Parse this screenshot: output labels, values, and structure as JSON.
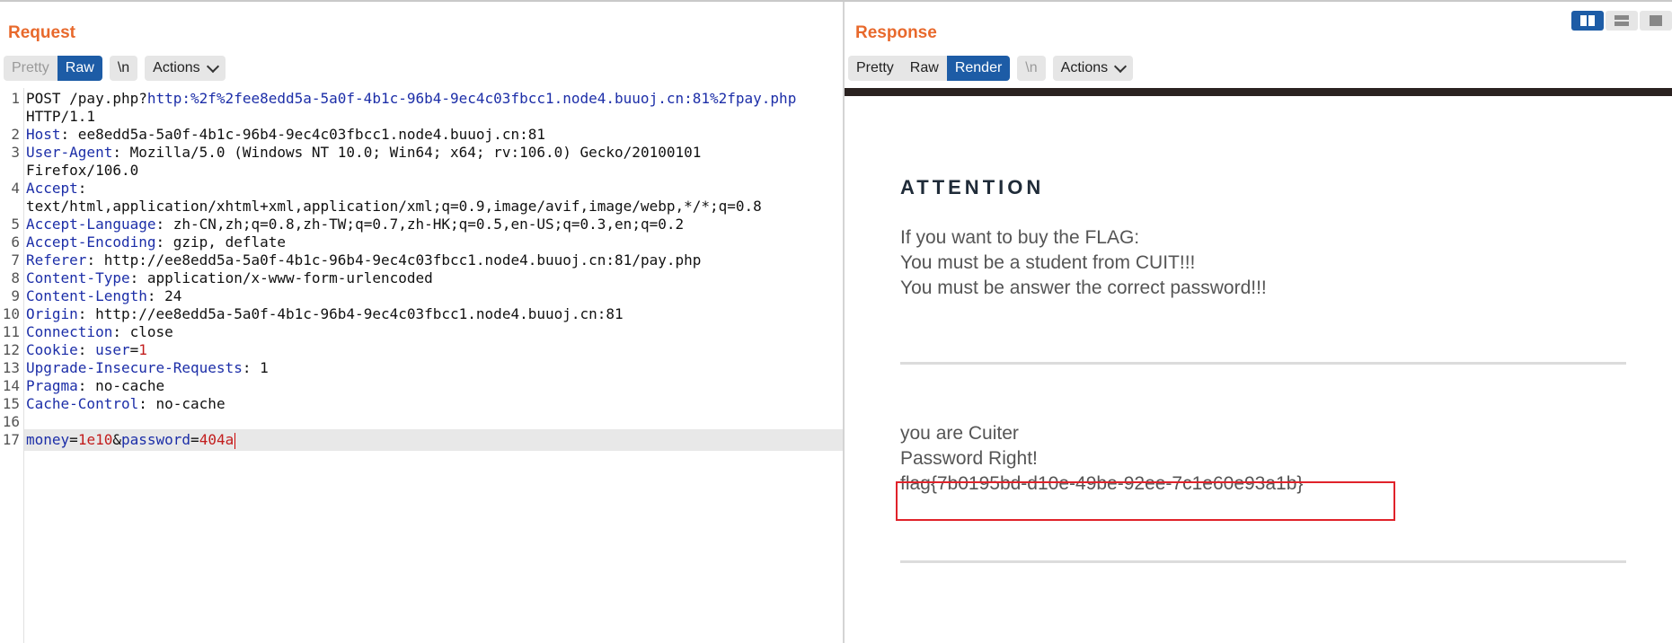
{
  "request": {
    "title": "Request",
    "tabs": [
      "Pretty",
      "Raw",
      "\\n"
    ],
    "actions_label": "Actions",
    "line_numbers": [
      "1",
      "2",
      "3",
      "4",
      "5",
      "6",
      "7",
      "8",
      "9",
      "10",
      "11",
      "12",
      "13",
      "14",
      "15",
      "16",
      "17"
    ],
    "line1_method": "POST /pay.php?",
    "line1_url": "http:%2f%2fee8edd5a-5a0f-4b1c-96b4-9ec4c03fbcc1.node4.buuoj.cn:81%2fpay.php",
    "line1_cont": "HTTP/1.1",
    "headers": [
      {
        "name": "Host",
        "value": " ee8edd5a-5a0f-4b1c-96b4-9ec4c03fbcc1.node4.buuoj.cn:81"
      },
      {
        "name": "User-Agent",
        "value": " Mozilla/5.0 (Windows NT 10.0; Win64; x64; rv:106.0) Gecko/20100101",
        "cont": "Firefox/106.0"
      },
      {
        "name": "Accept",
        "value": "",
        "cont": "text/html,application/xhtml+xml,application/xml;q=0.9,image/avif,image/webp,*/*;q=0.8"
      },
      {
        "name": "Accept-Language",
        "value": " zh-CN,zh;q=0.8,zh-TW;q=0.7,zh-HK;q=0.5,en-US;q=0.3,en;q=0.2"
      },
      {
        "name": "Accept-Encoding",
        "value": " gzip, deflate"
      },
      {
        "name": "Referer",
        "value": " http://ee8edd5a-5a0f-4b1c-96b4-9ec4c03fbcc1.node4.buuoj.cn:81/pay.php"
      },
      {
        "name": "Content-Type",
        "value": " application/x-www-form-urlencoded"
      },
      {
        "name": "Content-Length",
        "value": " 24"
      },
      {
        "name": "Origin",
        "value": " http://ee8edd5a-5a0f-4b1c-96b4-9ec4c03fbcc1.node4.buuoj.cn:81"
      },
      {
        "name": "Connection",
        "value": " close"
      },
      {
        "name": "Cookie",
        "value": " "
      },
      {
        "name": "Upgrade-Insecure-Requests",
        "value": " 1"
      },
      {
        "name": "Pragma",
        "value": " no-cache"
      },
      {
        "name": "Cache-Control",
        "value": " no-cache"
      }
    ],
    "cookie_name": "user",
    "cookie_value": "1",
    "body": {
      "p1_name": "money",
      "p1_value": "1e10",
      "p2_name": "password",
      "p2_value": "404a"
    }
  },
  "response": {
    "title": "Response",
    "tabs": [
      "Pretty",
      "Raw",
      "Render",
      "\\n"
    ],
    "actions_label": "Actions",
    "render": {
      "heading": "ATTENTION",
      "lines": [
        "If you want to buy the FLAG:",
        "You must be a student from CUIT!!!",
        "You must be answer the correct password!!!"
      ],
      "result_lines": [
        "you are Cuiter",
        "Password Right!"
      ],
      "flag": "flag{7b0195bd-d10e-49be-92ee-7c1e60e93a1b}"
    }
  },
  "colors": {
    "accent_orange": "#e8692c",
    "active_tab_blue": "#1d5ca6",
    "header_blue": "#1c2ea8",
    "value_red": "#c21d1d",
    "flag_box_red": "#e0222a"
  }
}
